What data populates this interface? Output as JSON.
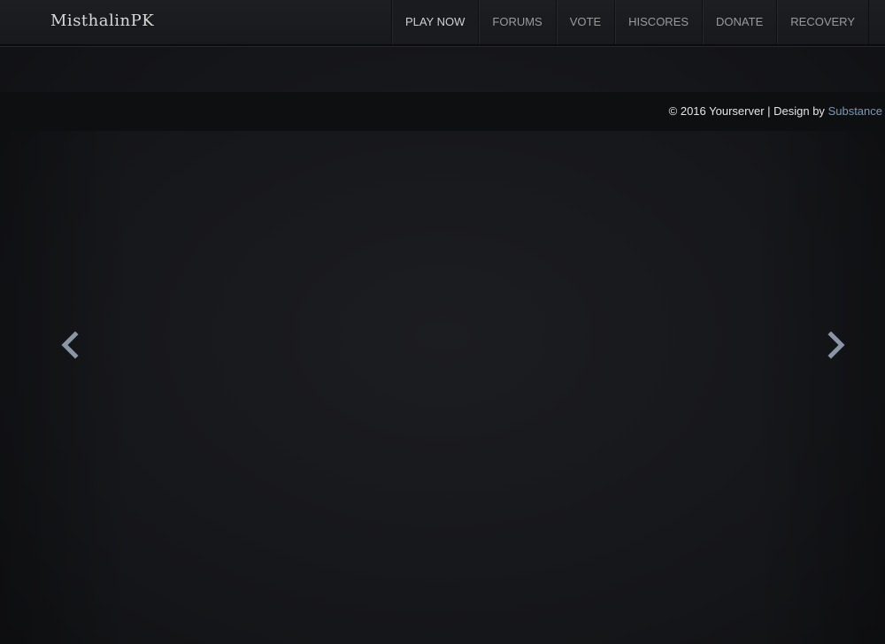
{
  "brand": {
    "name": "MisthalinPK"
  },
  "nav": {
    "items": [
      {
        "label": "PLAY NOW",
        "active": true
      },
      {
        "label": "FORUMS"
      },
      {
        "label": "VOTE"
      },
      {
        "label": "HISCORES"
      },
      {
        "label": "DONATE"
      },
      {
        "label": "RECOVERY"
      }
    ]
  },
  "footer": {
    "copyright": "© 2016 Yourserver | Design by",
    "link_label": "Substance",
    "link_color": "#7f97b3"
  },
  "carousel": {
    "prev_icon": "chevron-left-icon",
    "next_icon": "chevron-right-icon",
    "arrow_color": "#8a96a6"
  }
}
